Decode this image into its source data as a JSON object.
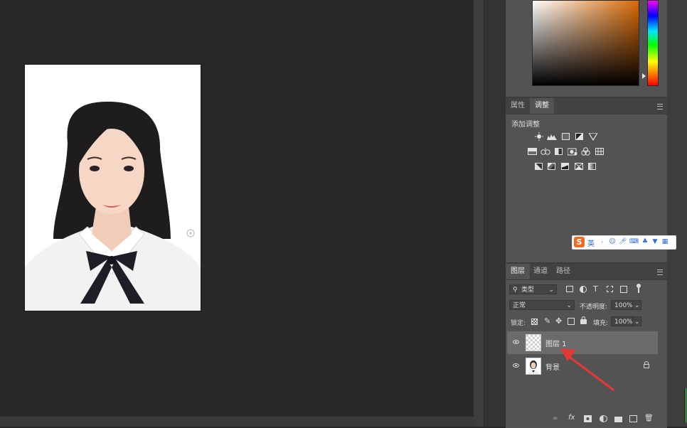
{
  "properties_panel": {
    "tabs": [
      "属性",
      "调整"
    ],
    "active_tab": "调整",
    "heading": "添加调整"
  },
  "layers_panel": {
    "tabs": [
      "图层",
      "通道",
      "路径"
    ],
    "active_tab": "图层",
    "filter_kind": "类型",
    "blend_mode": "正常",
    "opacity_label": "不透明度:",
    "opacity_value": "100%",
    "lock_label": "锁定:",
    "fill_label": "填充:",
    "fill_value": "100%",
    "layers": [
      {
        "name": "图层 1",
        "selected": true
      },
      {
        "name": "背景",
        "selected": false
      }
    ]
  },
  "ime_toolbar": {
    "logo": "S",
    "mode": "英"
  },
  "colors": {
    "canvas_bg": "#282828",
    "panel_bg": "#535353",
    "accent_orange": "#d96a06",
    "annotation_arrow": "#e53935",
    "ime_blue": "#2b6cd8"
  }
}
